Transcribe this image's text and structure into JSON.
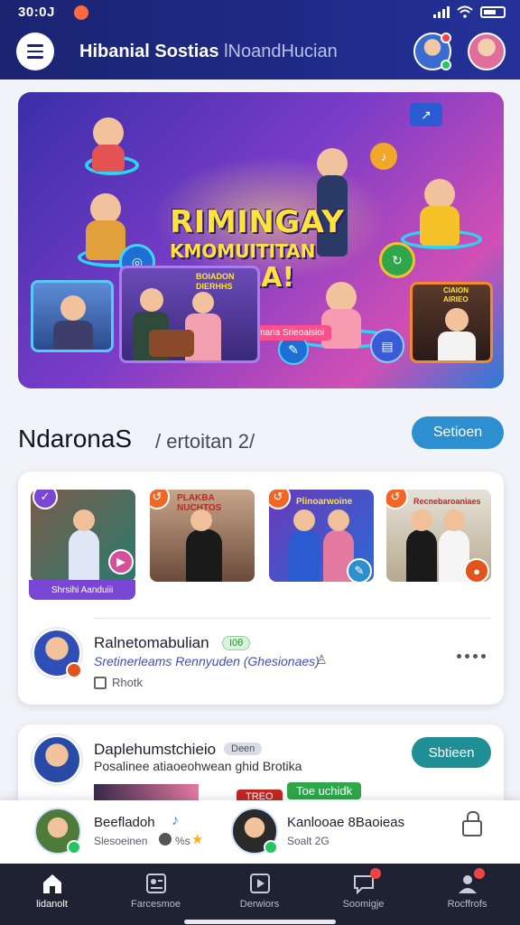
{
  "status": {
    "time": "30:0J"
  },
  "header": {
    "title_main": "Hibanial Sostias",
    "title_sub": "lNoandHucian"
  },
  "hero": {
    "line1": "RIMINGAY",
    "line2": "KMOMUITITAN",
    "line3": "VIBDLA!",
    "subtitle": "Noufac forecerhmaria Srieoaisioi",
    "photo_label": "BOIADON DIERHHS",
    "photo2_label": "CIAION AIRIEO"
  },
  "section": {
    "title": "NdaronaS",
    "subtitle": "/ ertoitan 2/",
    "button": "Setioen"
  },
  "thumbnails": [
    {
      "label": "Shrsihi Aanduiii",
      "accent": "#7a46d6"
    },
    {
      "label": "PLAKBA NUCHTOS",
      "accent": "#f26522"
    },
    {
      "label": "Plinoarwoine",
      "accent": "#f26522"
    },
    {
      "label": "Recnebaroaniaes",
      "accent": "#f26522"
    }
  ],
  "row1": {
    "name": "Ralnetomabulian",
    "badge": "I0θ",
    "sub": "Sretinerleams Rennyuden (Ghesionaes)",
    "meta": "Rhotk"
  },
  "row2": {
    "name": "Daplehumstchieio",
    "badge": "Deen",
    "sub": "Posalinee atiaoeohwean ghid Brotika",
    "button": "Sbtieen",
    "chip": "Toe uchidk",
    "chip2": "TREO"
  },
  "dock": {
    "left_name": "Beefladoh",
    "left_sub": "Slesoeinen",
    "left_sub2": "%s",
    "right_name": "Kanlooae 8Baoieas",
    "right_sub": "Soalt 2G"
  },
  "nav": [
    {
      "label": "lidanolt",
      "icon": "home-icon",
      "active": true
    },
    {
      "label": "Farcesmoe",
      "icon": "id-card-icon",
      "active": false
    },
    {
      "label": "Derwiors",
      "icon": "play-square-icon",
      "active": false
    },
    {
      "label": "Soomigje",
      "icon": "chat-icon",
      "active": false
    },
    {
      "label": "Rocffrofs",
      "icon": "profile-icon",
      "active": false
    }
  ],
  "colors": {
    "header": "#1b2472",
    "accent_blue": "#2e8fd0",
    "accent_teal": "#1f8f96",
    "nav_bg": "#1e2233"
  }
}
